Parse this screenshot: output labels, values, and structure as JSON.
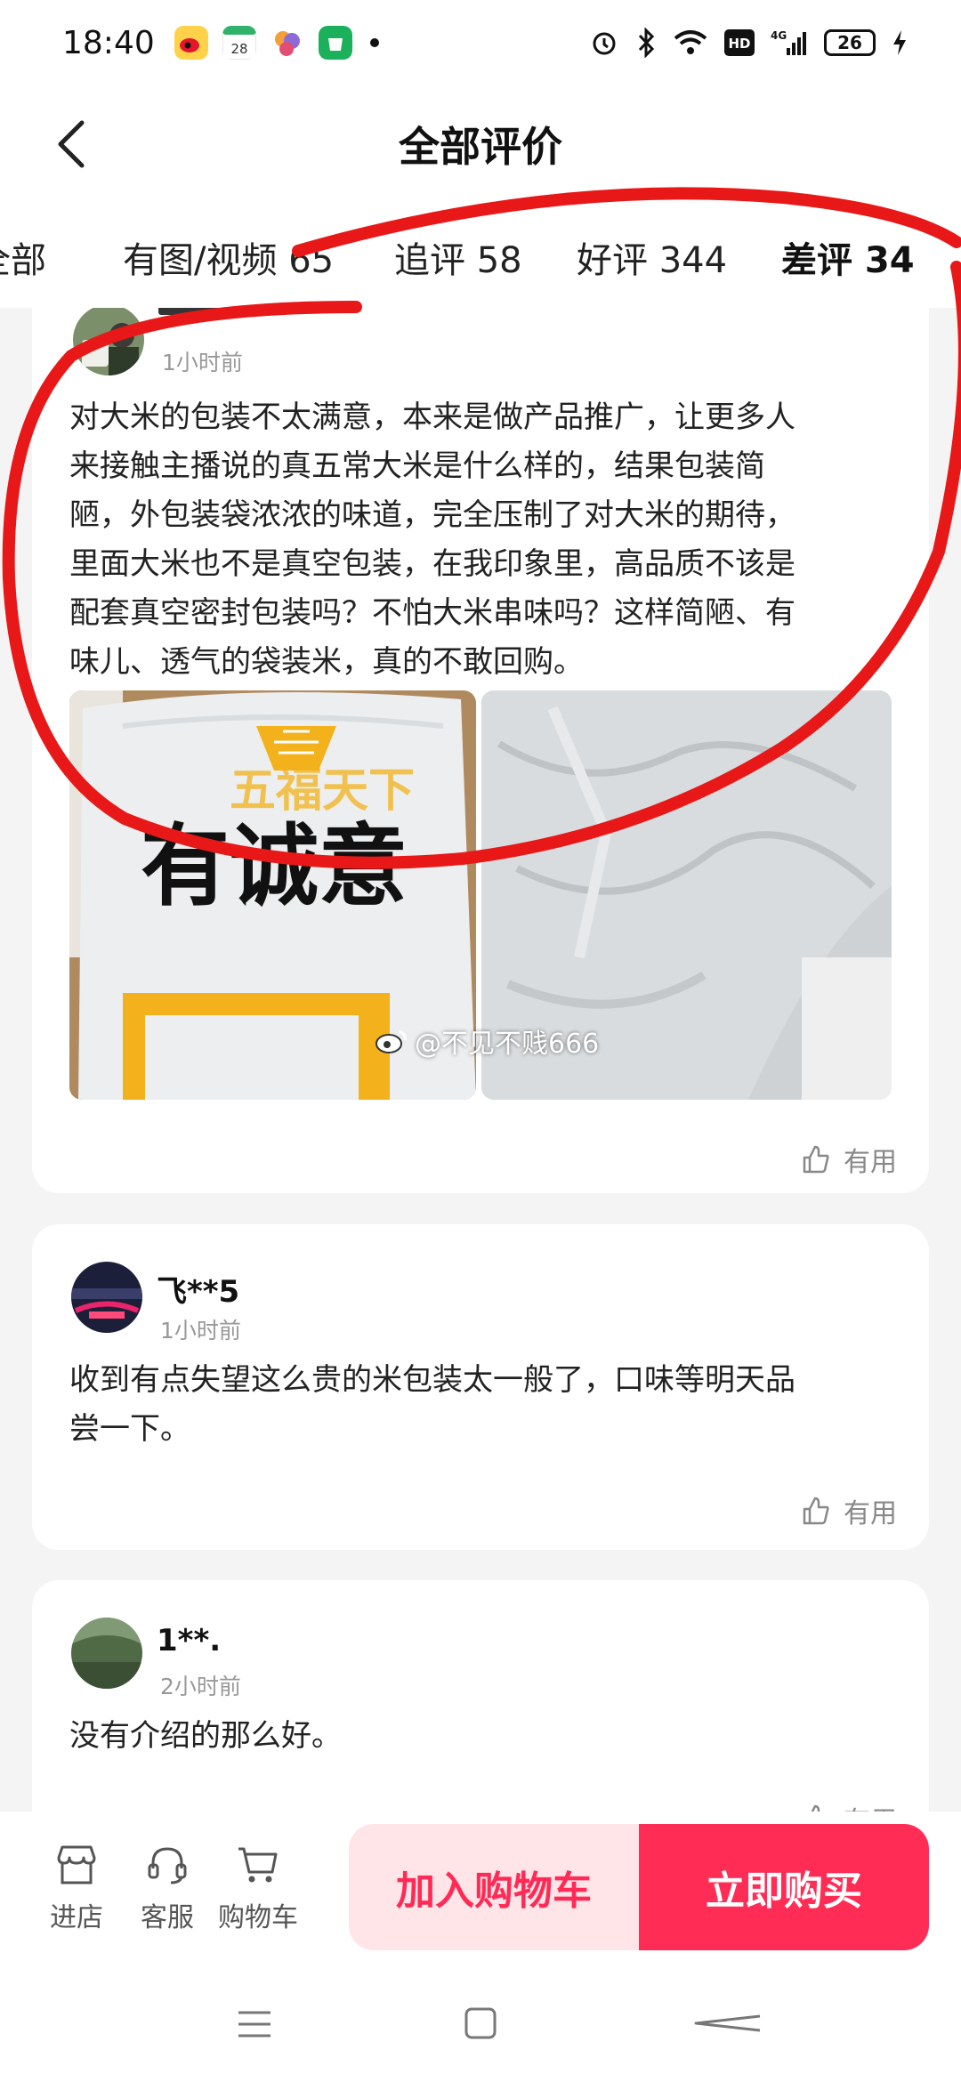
{
  "status_bar": {
    "time": "18:40",
    "battery": "26"
  },
  "header": {
    "title": "全部评价"
  },
  "tabs": [
    {
      "label": "全部"
    },
    {
      "label": "有图/视频 65"
    },
    {
      "label": "追评 58"
    },
    {
      "label": "好评 344"
    },
    {
      "label": "差评 34"
    }
  ],
  "reviews": [
    {
      "time": "1小时前",
      "text_lines": [
        "对大米的包装不太满意，本来是做产品推广，让更多人",
        "来接触主播说的真五常大米是什么样的，结果包装简",
        "陋，外包装袋浓浓的味道，完全压制了对大米的期待，",
        "里面大米也不是真空包装，在我印象里，高品质不该是",
        "配套真空密封包装吗？不怕大米串味吗？这样简陋、有",
        "味儿、透气的袋装米，真的不敢回购。"
      ],
      "photo_text_brand": "五福天下",
      "photo_text_slogan": "有诚意",
      "useful": "有用"
    },
    {
      "user": "飞**5",
      "time": "1小时前",
      "text_lines": [
        "收到有点失望这么贵的米包装太一般了，口味等明天品",
        "尝一下。"
      ],
      "useful": "有用"
    },
    {
      "user": "1**.",
      "time": "2小时前",
      "text_lines": [
        "没有介绍的那么好。"
      ],
      "useful": "有用"
    }
  ],
  "watermark": "@不见不贱666",
  "bottom_bar": {
    "shop": "进店",
    "service": "客服",
    "cart": "购物车",
    "add_to_cart": "加入购物车",
    "buy_now": "立即购买"
  },
  "colors": {
    "accent": "#ff2d55",
    "accent_light": "#ffe4e8",
    "annotation": "#e81818"
  }
}
